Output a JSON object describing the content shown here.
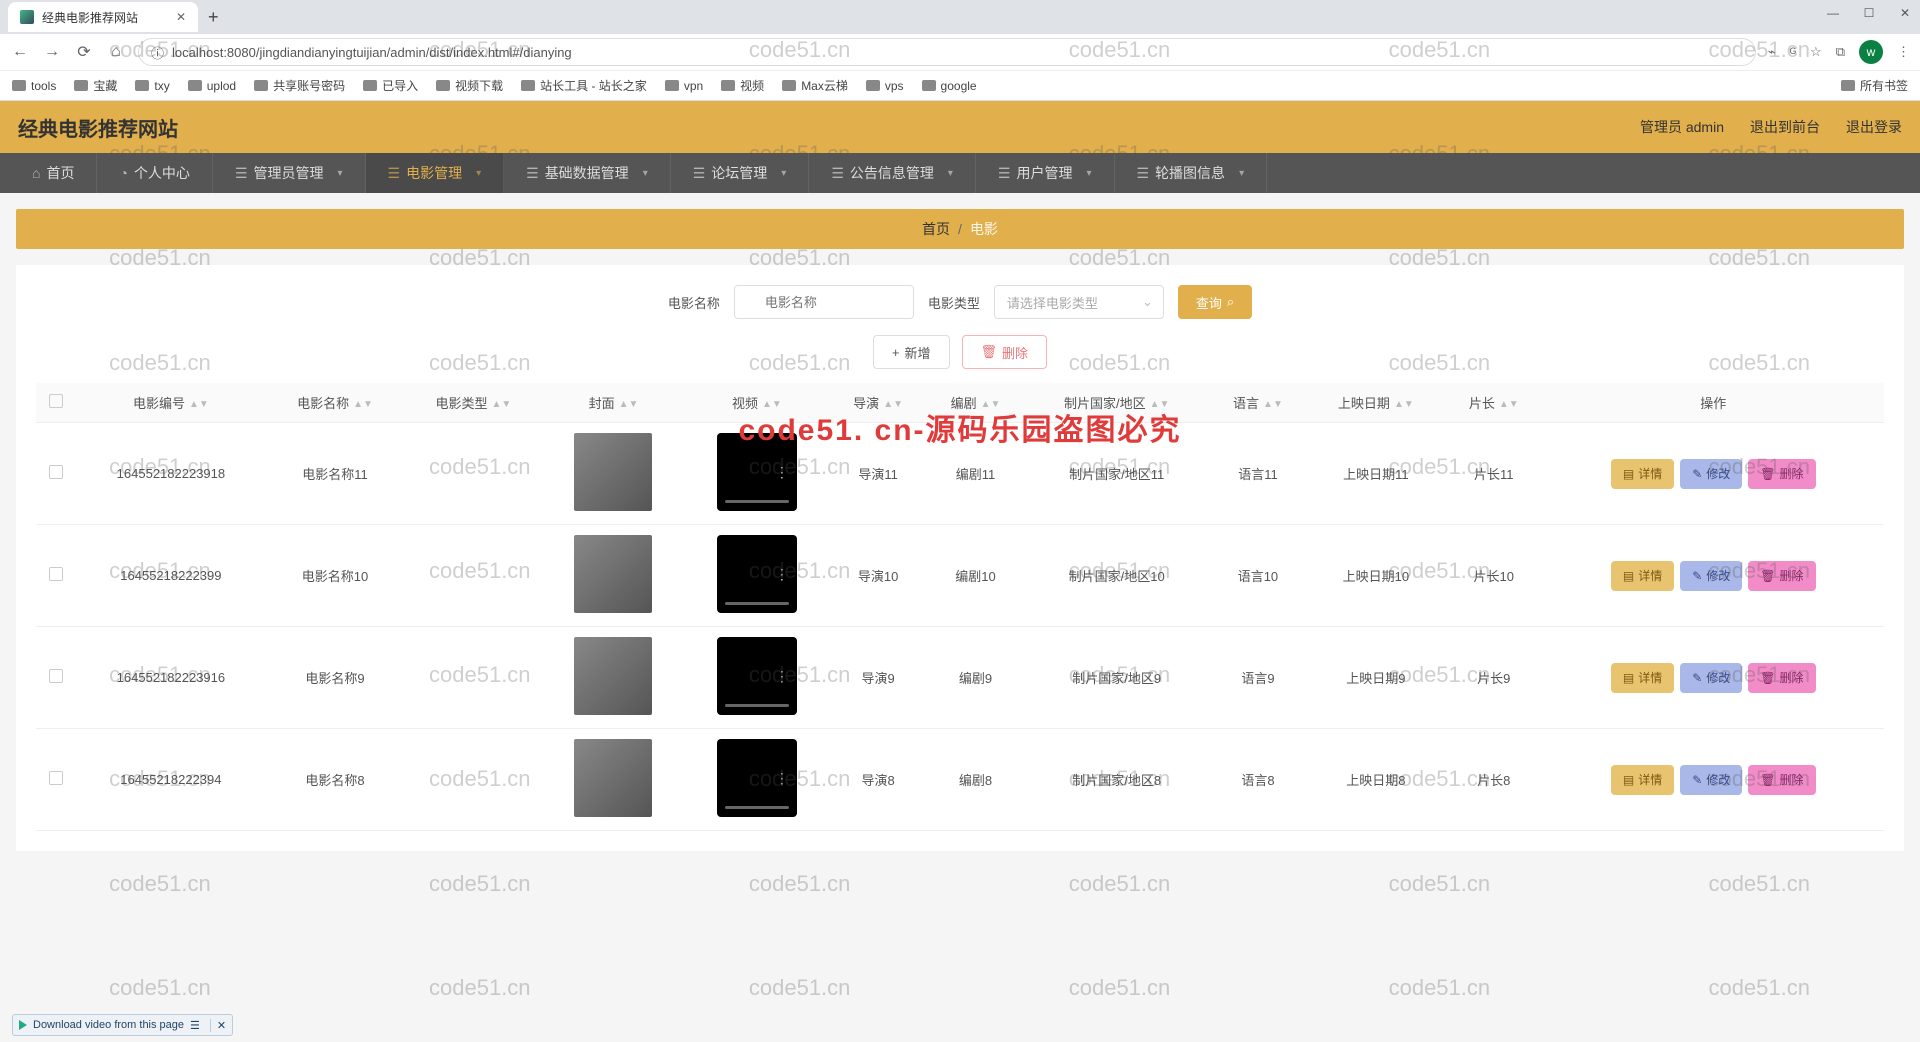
{
  "browser": {
    "tab_title": "经典电影推荐网站",
    "url": "localhost:8080/jingdiandianyingtuijian/admin/dist/index.html#/dianying",
    "avatar_letter": "w",
    "bookmarks": [
      "tools",
      "宝藏",
      "txy",
      "uplod",
      "共享账号密码",
      "已导入",
      "视频下载",
      "站长工具 - 站长之家",
      "vpn",
      "视频",
      "Max云梯",
      "vps",
      "google"
    ],
    "all_bookmarks": "所有书签"
  },
  "watermark": {
    "text": "code51.cn",
    "banner": "code51. cn-源码乐园盗图必究"
  },
  "header": {
    "title": "经典电影推荐网站",
    "admin_label": "管理员 admin",
    "logout_front": "退出到前台",
    "logout": "退出登录"
  },
  "nav": [
    {
      "label": "首页",
      "icon": "⌂"
    },
    {
      "label": "个人中心",
      "icon": "◔"
    },
    {
      "label": "管理员管理",
      "icon": "☰",
      "caret": true
    },
    {
      "label": "电影管理",
      "icon": "☰",
      "caret": true,
      "active": true
    },
    {
      "label": "基础数据管理",
      "icon": "☰",
      "caret": true
    },
    {
      "label": "论坛管理",
      "icon": "☰",
      "caret": true
    },
    {
      "label": "公告信息管理",
      "icon": "☰",
      "caret": true
    },
    {
      "label": "用户管理",
      "icon": "☰",
      "caret": true
    },
    {
      "label": "轮播图信息",
      "icon": "☰",
      "caret": true
    }
  ],
  "breadcrumb": {
    "home": "首页",
    "sep": "/",
    "current": "电影"
  },
  "search": {
    "name_label": "电影名称",
    "name_placeholder": "电影名称",
    "type_label": "电影类型",
    "type_placeholder": "请选择电影类型",
    "query": "查询"
  },
  "actions": {
    "add": "新增",
    "delete": "删除"
  },
  "columns": [
    "电影编号",
    "电影名称",
    "电影类型",
    "封面",
    "视频",
    "导演",
    "编剧",
    "制片国家/地区",
    "语言",
    "上映日期",
    "片长",
    "操作"
  ],
  "row_action_labels": {
    "detail": "详情",
    "edit": "修改",
    "delete": "删除"
  },
  "chart_data": {
    "type": "table",
    "columns": [
      "电影编号",
      "电影名称",
      "电影类型",
      "封面",
      "视频",
      "导演",
      "编剧",
      "制片国家/地区",
      "语言",
      "上映日期",
      "片长"
    ],
    "rows": [
      {
        "id": "164552182223918",
        "name": "电影名称11",
        "type": "",
        "director": "导演11",
        "writer": "编剧11",
        "country": "制片国家/地区11",
        "lang": "语言11",
        "date": "上映日期11",
        "length": "片长11"
      },
      {
        "id": "16455218222399",
        "name": "电影名称10",
        "type": "",
        "director": "导演10",
        "writer": "编剧10",
        "country": "制片国家/地区10",
        "lang": "语言10",
        "date": "上映日期10",
        "length": "片长10"
      },
      {
        "id": "164552182223916",
        "name": "电影名称9",
        "type": "",
        "director": "导演9",
        "writer": "编剧9",
        "country": "制片国家/地区9",
        "lang": "语言9",
        "date": "上映日期9",
        "length": "片长9"
      },
      {
        "id": "16455218222394",
        "name": "电影名称8",
        "type": "",
        "director": "导演8",
        "writer": "编剧8",
        "country": "制片国家/地区8",
        "lang": "语言8",
        "date": "上映日期8",
        "length": "片长8"
      }
    ]
  },
  "download_bar": "Download video from this page"
}
